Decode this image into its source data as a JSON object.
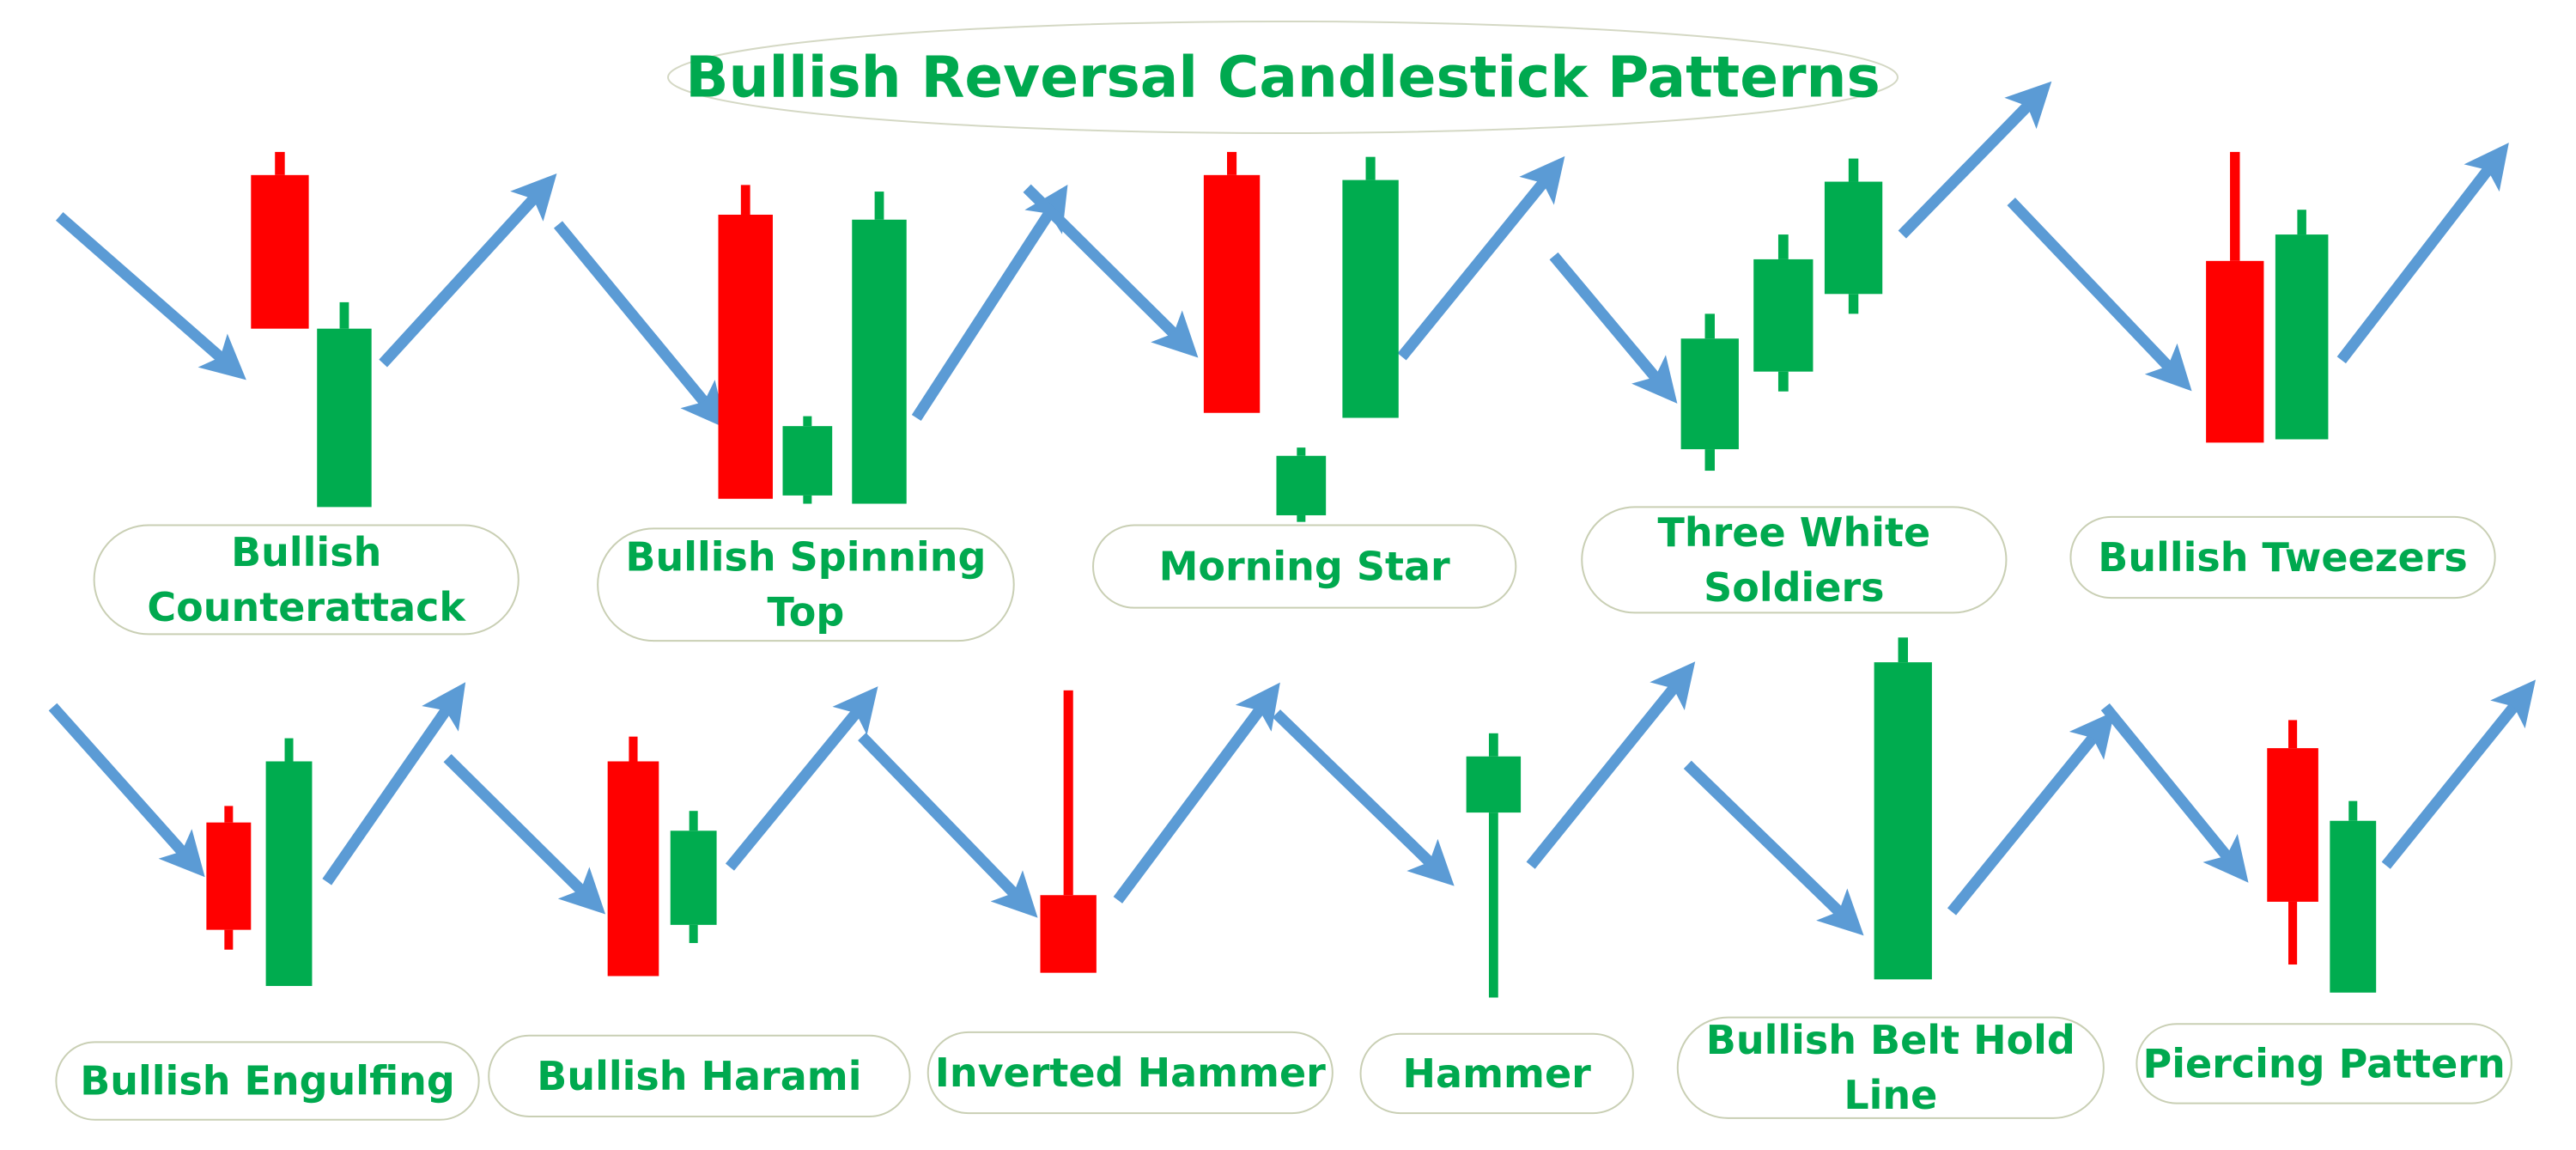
{
  "chart_data": {
    "type": "candlestick-pattern-infographic",
    "title": "Bullish Reversal Candlestick Patterns",
    "colors": {
      "bullish": "#00ac4f",
      "bearish": "#ff0000",
      "trend_arrow": "#5b9bd5",
      "label_text": "#00a94f",
      "label_border": "#c9cfb4"
    },
    "price_scale_note": "candle values are relative price levels (higher = up) within each pattern",
    "patterns": [
      {
        "name": "Bullish Counterattack",
        "label_lines": [
          "Bullish",
          "Counterattack"
        ],
        "trend_before": "down",
        "trend_after": "up",
        "candles": [
          {
            "color": "bearish",
            "open": 201,
            "high": 215,
            "low": 108,
            "close": 108
          },
          {
            "color": "bullish",
            "open": 0,
            "high": 124,
            "low": 0,
            "close": 108
          }
        ]
      },
      {
        "name": "Bullish Spinning Top",
        "label_lines": [
          "Bullish Spinning",
          "Top"
        ],
        "trend_before": "down",
        "trend_after": "up",
        "candles": [
          {
            "color": "bearish",
            "open": 175,
            "high": 193,
            "low": 3,
            "close": 3
          },
          {
            "color": "bullish",
            "open": 5,
            "high": 53,
            "low": 0,
            "close": 47
          },
          {
            "color": "bullish",
            "open": 0,
            "high": 189,
            "low": 0,
            "close": 172
          }
        ]
      },
      {
        "name": "Morning Star",
        "label_lines": [
          "Morning Star"
        ],
        "trend_before": "down",
        "trend_after": "up",
        "candles": [
          {
            "color": "bearish",
            "open": 210,
            "high": 224,
            "low": 66,
            "close": 66
          },
          {
            "color": "bullish",
            "open": 4,
            "high": 45,
            "low": 0,
            "close": 40
          },
          {
            "color": "bullish",
            "open": 63,
            "high": 221,
            "low": 63,
            "close": 207
          }
        ]
      },
      {
        "name": "Three White Soldiers",
        "label_lines": [
          "Three White",
          "Soldiers"
        ],
        "trend_before": "down",
        "trend_after": "up",
        "candles": [
          {
            "color": "bullish",
            "open": 13,
            "high": 95,
            "low": 0,
            "close": 80
          },
          {
            "color": "bullish",
            "open": 60,
            "high": 143,
            "low": 48,
            "close": 128
          },
          {
            "color": "bullish",
            "open": 107,
            "high": 189,
            "low": 95,
            "close": 175
          }
        ]
      },
      {
        "name": "Bullish Tweezers",
        "label_lines": [
          "Bullish Tweezers"
        ],
        "trend_before": "down",
        "trend_after": "up",
        "candles": [
          {
            "color": "bearish",
            "open": 110,
            "high": 176,
            "low": 0,
            "close": 0
          },
          {
            "color": "bullish",
            "open": 2,
            "high": 141,
            "low": 2,
            "close": 126
          }
        ]
      },
      {
        "name": "Bullish Engulfing",
        "label_lines": [
          "Bullish Engulfing"
        ],
        "trend_before": "down",
        "trend_after": "up",
        "candles": [
          {
            "color": "bearish",
            "open": 99,
            "high": 109,
            "low": 22,
            "close": 34
          },
          {
            "color": "bullish",
            "open": 0,
            "high": 150,
            "low": 0,
            "close": 136
          }
        ]
      },
      {
        "name": "Bullish Harami",
        "label_lines": [
          "Bullish Harami"
        ],
        "trend_before": "down",
        "trend_after": "up",
        "candles": [
          {
            "color": "bearish",
            "open": 130,
            "high": 145,
            "low": 0,
            "close": 0
          },
          {
            "color": "bullish",
            "open": 31,
            "high": 100,
            "low": 20,
            "close": 88
          }
        ]
      },
      {
        "name": "Inverted Hammer",
        "label_lines": [
          "Inverted Hammer"
        ],
        "trend_before": "down",
        "trend_after": "up",
        "candles": [
          {
            "color": "bearish",
            "open": 47,
            "high": 171,
            "low": 0,
            "close": 0
          }
        ]
      },
      {
        "name": "Hammer",
        "label_lines": [
          "Hammer"
        ],
        "trend_before": "down",
        "trend_after": "up",
        "candles": [
          {
            "color": "bullish",
            "open": 112,
            "high": 160,
            "low": 0,
            "close": 146
          }
        ]
      },
      {
        "name": "Bullish Belt Hold Line",
        "label_lines": [
          "Bullish Belt Hold",
          "Line"
        ],
        "trend_before": "down",
        "trend_after": "up",
        "candles": [
          {
            "color": "bullish",
            "open": 0,
            "high": 207,
            "low": 0,
            "close": 192
          }
        ]
      },
      {
        "name": "Piercing Pattern",
        "label_lines": [
          "Piercing Pattern"
        ],
        "trend_before": "down",
        "trend_after": "up",
        "candles": [
          {
            "color": "bearish",
            "open": 148,
            "high": 165,
            "low": 17,
            "close": 55
          },
          {
            "color": "bullish",
            "open": 0,
            "high": 116,
            "low": 0,
            "close": 104
          }
        ]
      }
    ]
  }
}
